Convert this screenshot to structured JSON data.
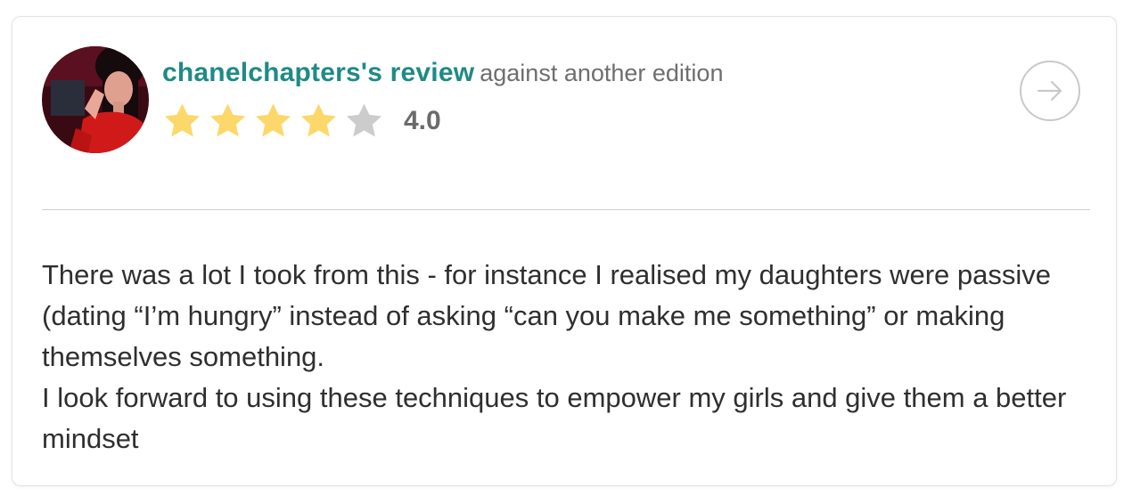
{
  "review": {
    "username": "chanelchapters's review",
    "edition_note": "against another edition",
    "rating_value": "4.0",
    "rating": 4,
    "max_rating": 5,
    "body_paragraphs": [
      "There was a lot I took from this - for instance I realised my daughters were passive (dating “I’m hungry” instead of asking “can you make me something” or making themselves something.",
      "I look forward to using these techniques to empower my girls and give them a better mindset"
    ]
  },
  "icons": {
    "avatar": "user-avatar-photo",
    "star": "star-icon",
    "arrow": "arrow-right-icon"
  },
  "colors": {
    "username": "#1f8a86",
    "star_filled": "#fcd86b",
    "star_empty": "#cccccc",
    "text": "#2f2f2f",
    "muted": "#6e6e6e"
  }
}
